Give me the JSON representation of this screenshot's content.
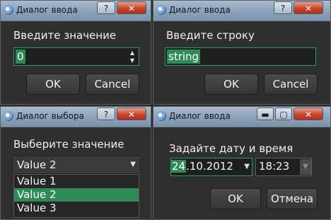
{
  "dialog_int": {
    "title": "Диалог ввода",
    "help": "?",
    "close": "✕",
    "prompt": "Введите значение",
    "value": "0",
    "ok": "OK",
    "cancel": "Cancel"
  },
  "dialog_text": {
    "title": "Диалог ввода",
    "help": "?",
    "close": "✕",
    "prompt": "Введите строку",
    "value": "string",
    "ok": "OK",
    "cancel": "Cancel"
  },
  "dialog_item": {
    "title": "Диалог выбора",
    "help": "?",
    "close": "✕",
    "prompt": "Выберите значение",
    "selected": "Value 2",
    "options": [
      "Value 1",
      "Value 2",
      "Value 3"
    ],
    "active_index": 1
  },
  "dialog_datetime": {
    "title": "Диалог ввода",
    "close": "✕",
    "prompt": "Задайте дату и время",
    "date_day": "24",
    "date_rest": ".10.2012",
    "time": "18:23",
    "ok": "OK",
    "cancel": "Отмена"
  },
  "icons": {
    "app": "qt-app-icon",
    "spin_up": "up-arrow-icon",
    "spin_down": "down-arrow-icon",
    "dropdown": "chevron-down-icon",
    "minimize": "minimize-icon",
    "maximize": "maximize-icon"
  },
  "colors": {
    "selection": "#2e8b57",
    "focus_border": "#2f9a64",
    "titlebar": "#8fa6bd",
    "background": "#2f2f2f"
  }
}
